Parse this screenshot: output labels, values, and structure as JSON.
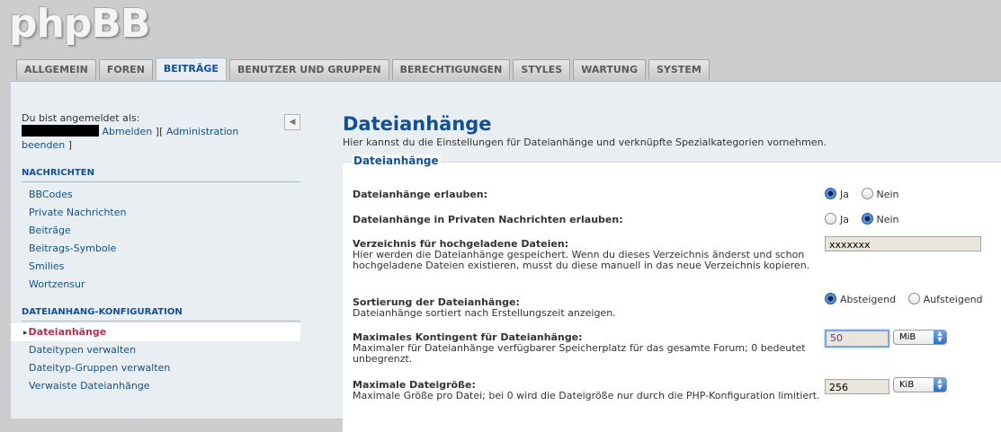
{
  "logo": "phpBB",
  "tabs": [
    {
      "label": "ALLGEMEIN"
    },
    {
      "label": "FOREN"
    },
    {
      "label": "BEITRÄGE",
      "active": true
    },
    {
      "label": "BENUTZER UND GRUPPEN"
    },
    {
      "label": "BERECHTIGUNGEN"
    },
    {
      "label": "STYLES"
    },
    {
      "label": "WARTUNG"
    },
    {
      "label": "SYSTEM"
    }
  ],
  "login": {
    "prefix": "Du bist angemeldet als:",
    "logout": "Abmelden",
    "sep": " ][ ",
    "admin_end_1": "Administration",
    "admin_end_2": "beenden",
    "close": " ]"
  },
  "menu": {
    "section1": "NACHRICHTEN",
    "items1": [
      "BBCodes",
      "Private Nachrichten",
      "Beiträge",
      "Beitrags-Symbole",
      "Smilies",
      "Wortzensur"
    ],
    "section2": "DATEIANHANG-KONFIGURATION",
    "items2": [
      "Dateianhänge",
      "Dateitypen verwalten",
      "Dateityp-Gruppen verwalten",
      "Verwaiste Dateianhänge"
    ]
  },
  "main": {
    "title": "Dateianhänge",
    "desc": "Hier kannst du die Einstellungen für Dateianhänge und verknüpfte Spezialkategorien vornehmen.",
    "legend": "Dateianhänge",
    "rows": {
      "allow": {
        "label": "Dateianhänge erlauben:",
        "opt_yes": "Ja",
        "opt_no": "Nein"
      },
      "pm": {
        "label": "Dateianhänge in Privaten Nachrichten erlauben:",
        "opt_yes": "Ja",
        "opt_no": "Nein"
      },
      "dir": {
        "label": "Verzeichnis für hochgeladene Dateien:",
        "expl": "Hier werden die Dateianhänge gespeichert. Wenn du dieses Verzeichnis änderst und schon hochgeladene Dateien existieren, musst du diese manuell in das neue Verzeichnis kopieren.",
        "value": "xxxxxxx"
      },
      "sort": {
        "label": "Sortierung der Dateianhänge:",
        "expl": "Dateianhänge sortiert nach Erstellungszeit anzeigen.",
        "opt_desc": "Absteigend",
        "opt_asc": "Aufsteigend"
      },
      "quota": {
        "label": "Maximales Kontingent für Dateianhänge:",
        "expl": "Maximaler für Dateianhänge verfügbarer Speicherplatz für das gesamte Forum; 0 bedeutet unbegrenzt.",
        "value": "50",
        "unit": "MiB"
      },
      "maxsize": {
        "label": "Maximale Dateigröße:",
        "expl": "Maximale Größe pro Datei; bei 0 wird die Dateigröße nur durch die PHP-Konfiguration limitiert.",
        "value": "256",
        "unit": "KiB"
      }
    }
  }
}
